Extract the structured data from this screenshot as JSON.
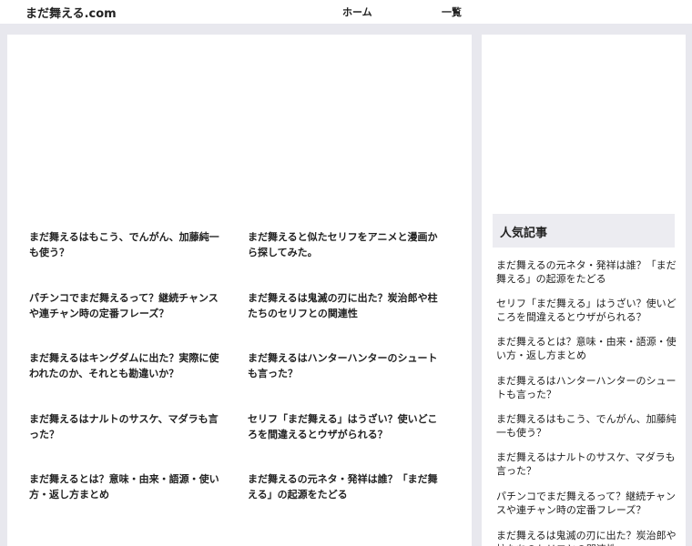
{
  "header": {
    "logo": "まだ舞える.com",
    "nav": [
      "ホーム",
      "一覧"
    ]
  },
  "articles": [
    "まだ舞えるはもこう、でんがん、加藤純一も使う？",
    "まだ舞えると似たセリフをアニメと漫画から探してみた。",
    "パチンコでまだ舞えるって？継続チャンスや連チャン時の定番フレーズ？",
    "まだ舞えるは鬼滅の刃に出た？炭治郎や柱たちのセリフとの関連性",
    "まだ舞えるはキングダムに出た？実際に使われたのか、それとも勘違いか？",
    "まだ舞えるはハンターハンターのシュートも言った？",
    "まだ舞えるはナルトのサスケ、マダラも言った？",
    "セリフ「まだ舞える」はうざい？使いどころを間違えるとウザがられる？",
    "まだ舞えるとは？意味・由来・語源・使い方・返し方まとめ",
    "まだ舞えるの元ネタ・発祥は誰？「まだ舞える」の起源をたどる"
  ],
  "sidebar": {
    "heading": "人気記事",
    "items": [
      "まだ舞えるの元ネタ・発祥は誰？「まだ舞える」の起源をたどる",
      "セリフ「まだ舞える」はうざい？使いどころを間違えるとウザがられる？",
      "まだ舞えるとは？意味・由来・語源・使い方・返し方まとめ",
      "まだ舞えるはハンターハンターのシュートも言った？",
      "まだ舞えるはもこう、でんがん、加藤純一も使う？",
      "まだ舞えるはナルトのサスケ、マダラも言った？",
      "パチンコでまだ舞えるって？継続チャンスや連チャン時の定番フレーズ？",
      "まだ舞えるは鬼滅の刃に出た？炭治郎や柱たちのセリフとの関連性"
    ]
  }
}
